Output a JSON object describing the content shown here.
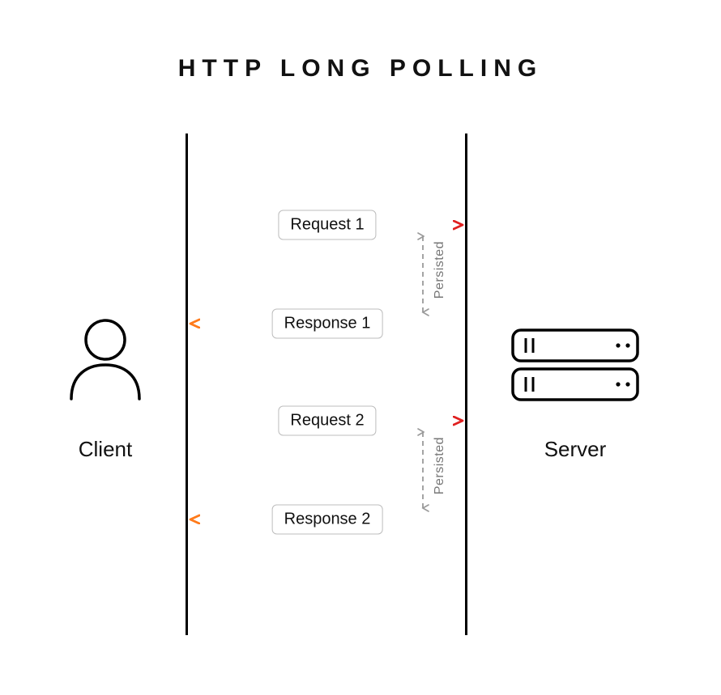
{
  "title": "HTTP LONG POLLING",
  "left_label": "Client",
  "right_label": "Server",
  "messages": {
    "req1": "Request 1",
    "res1": "Response 1",
    "req2": "Request 2",
    "res2": "Response 2"
  },
  "persisted_label": "Persisted",
  "colors": {
    "arrow_start": "#ff7a1a",
    "arrow_end": "#e02020",
    "dashed": "#9a9a9a"
  },
  "chart_data": {
    "type": "sequence-diagram",
    "title": "HTTP Long Polling",
    "participants": [
      "Client",
      "Server"
    ],
    "events": [
      {
        "from": "Client",
        "to": "Server",
        "label": "Request 1"
      },
      {
        "state": "Persisted",
        "at": "Server",
        "between": [
          "Request 1",
          "Response 1"
        ]
      },
      {
        "from": "Server",
        "to": "Client",
        "label": "Response 1"
      },
      {
        "from": "Client",
        "to": "Server",
        "label": "Request 2"
      },
      {
        "state": "Persisted",
        "at": "Server",
        "between": [
          "Request 2",
          "Response 2"
        ]
      },
      {
        "from": "Server",
        "to": "Client",
        "label": "Response 2"
      }
    ]
  }
}
